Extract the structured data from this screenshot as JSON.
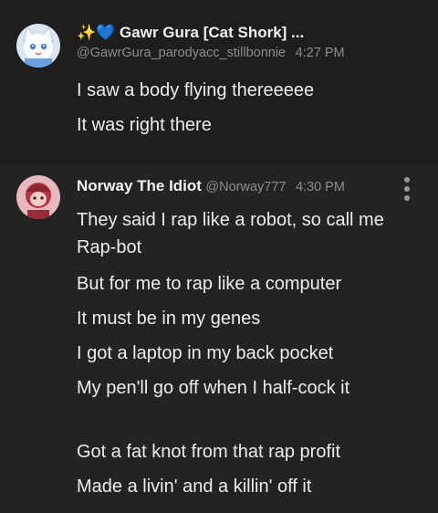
{
  "messages": [
    {
      "display_name": "✨💙 Gawr Gura [Cat Shork] ...",
      "handle": "@GawrGura_parodyacc_stillbonnie",
      "time": "4:27 PM",
      "avatar_icon": "white-cat-avatar",
      "lines": [
        "I saw a body flying thereeeee",
        "It was right there"
      ]
    },
    {
      "display_name": "Norway The Idiot",
      "handle": "@Norway777",
      "time": "4:30 PM",
      "avatar_icon": "red-character-avatar",
      "lines": [
        "They said I rap like a robot, so call me Rap-bot",
        "But for me to rap like a computer",
        "It must be in my genes",
        "I got a laptop in my back pocket",
        "My pen'll go off when I half-cock it",
        "Got a fat knot from that rap profit",
        "Made a livin' and a killin' off it"
      ]
    }
  ],
  "colors": {
    "background": "#1e1e1e",
    "hover_background": "#232323",
    "text": "#ececec",
    "muted": "#8d8d8d"
  }
}
